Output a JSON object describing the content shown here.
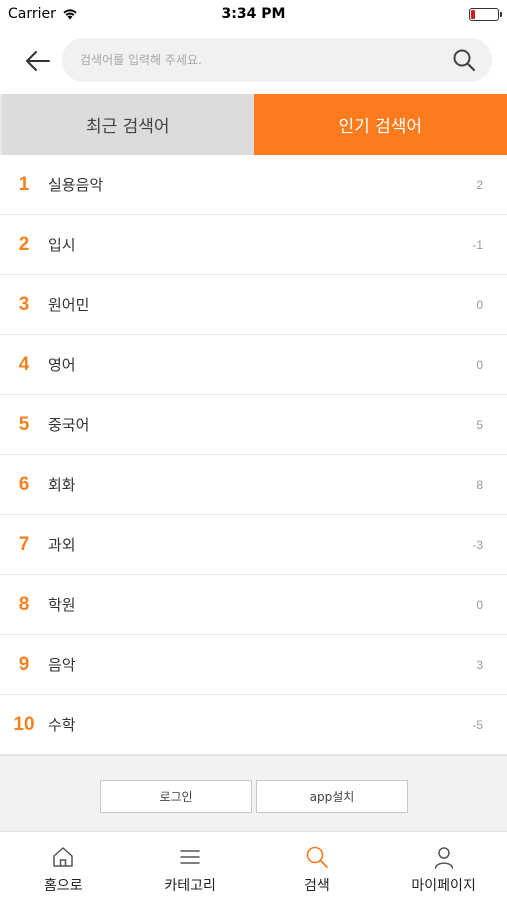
{
  "status_bar": {
    "carrier": "Carrier",
    "time": "3:34 PM"
  },
  "search": {
    "placeholder": "검색어를 입력해 주세요.",
    "value": ""
  },
  "tabs": [
    {
      "label": "최근 검색어",
      "active": false
    },
    {
      "label": "인기 검색어",
      "active": true
    }
  ],
  "keywords": [
    {
      "rank": "1",
      "keyword": "실용음악",
      "change": "2"
    },
    {
      "rank": "2",
      "keyword": "입시",
      "change": "-1"
    },
    {
      "rank": "3",
      "keyword": "원어민",
      "change": "0"
    },
    {
      "rank": "4",
      "keyword": "영어",
      "change": "0"
    },
    {
      "rank": "5",
      "keyword": "중국어",
      "change": "5"
    },
    {
      "rank": "6",
      "keyword": "회화",
      "change": "8"
    },
    {
      "rank": "7",
      "keyword": "과외",
      "change": "-3"
    },
    {
      "rank": "8",
      "keyword": "학원",
      "change": "0"
    },
    {
      "rank": "9",
      "keyword": "음악",
      "change": "3"
    },
    {
      "rank": "10",
      "keyword": "수학",
      "change": "-5"
    }
  ],
  "footer": {
    "login_label": "로그인",
    "app_install_label": "app설치"
  },
  "bottom_nav": [
    {
      "label": "홈으로",
      "icon": "home-icon"
    },
    {
      "label": "카테고리",
      "icon": "menu-icon"
    },
    {
      "label": "검색",
      "icon": "search-icon",
      "active": true
    },
    {
      "label": "마이페이지",
      "icon": "person-icon"
    }
  ],
  "colors": {
    "accent": "#fd7a1d",
    "rank": "#f58220",
    "battery_low": "#e0161e"
  }
}
